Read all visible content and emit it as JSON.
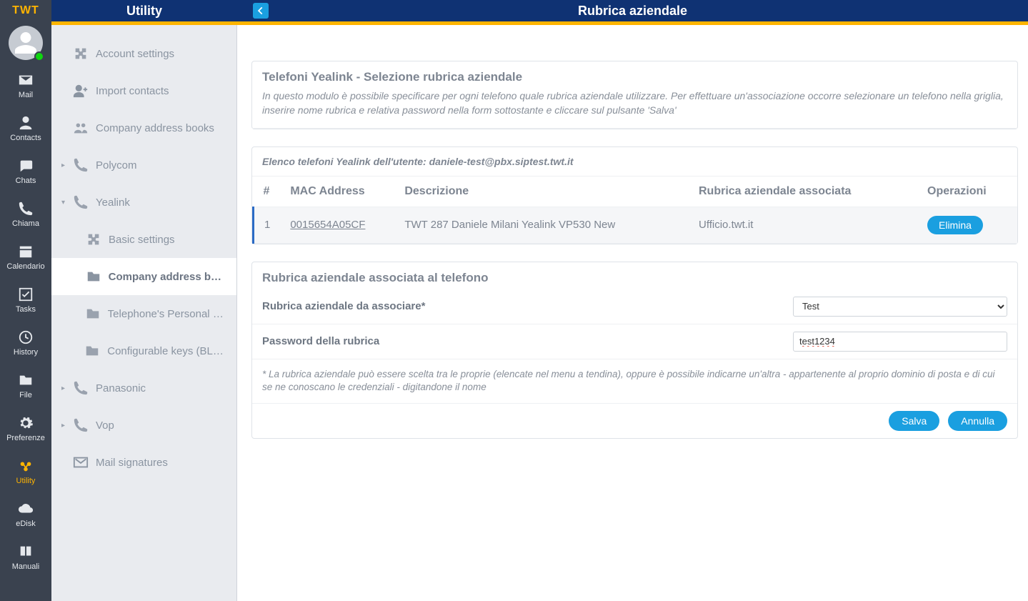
{
  "brand": "TWT",
  "header": {
    "left_title": "Utility",
    "right_title": "Rubrica aziendale"
  },
  "navrail": [
    {
      "id": "mail",
      "label": "Mail"
    },
    {
      "id": "contacts",
      "label": "Contacts"
    },
    {
      "id": "chats",
      "label": "Chats"
    },
    {
      "id": "chiama",
      "label": "Chiama"
    },
    {
      "id": "calendario",
      "label": "Calendario"
    },
    {
      "id": "tasks",
      "label": "Tasks"
    },
    {
      "id": "history",
      "label": "History"
    },
    {
      "id": "file",
      "label": "File"
    },
    {
      "id": "preferenze",
      "label": "Preferenze"
    },
    {
      "id": "utility",
      "label": "Utility",
      "active": true
    },
    {
      "id": "edisk",
      "label": "eDisk"
    },
    {
      "id": "manuali",
      "label": "Manuali"
    }
  ],
  "tree": [
    {
      "label": "Account settings",
      "icon": "puzzle"
    },
    {
      "label": "Import contacts",
      "icon": "person-plus"
    },
    {
      "label": "Company address books",
      "icon": "people"
    },
    {
      "label": "Polycom",
      "icon": "phone",
      "expander": "right"
    },
    {
      "label": "Yealink",
      "icon": "phone",
      "expander": "down"
    },
    {
      "label": "Basic settings",
      "icon": "puzzle",
      "child": true
    },
    {
      "label": "Company address book",
      "icon": "folder",
      "child": true,
      "active": true
    },
    {
      "label": "Telephone's Personal add…",
      "icon": "folder",
      "child": true
    },
    {
      "label": "Configurable keys (BLF - S…",
      "icon": "folder",
      "child": true
    },
    {
      "label": "Panasonic",
      "icon": "phone",
      "expander": "right"
    },
    {
      "label": "Vop",
      "icon": "phone",
      "expander": "right"
    },
    {
      "label": "Mail signatures",
      "icon": "mail"
    }
  ],
  "intro": {
    "title": "Telefoni Yealink - Selezione rubrica aziendale",
    "text": "In questo modulo è possibile specificare per ogni telefono quale rubrica aziendale utilizzare. Per effettuare un'associazione occorre selezionare un telefono nella griglia, inserire nome rubrica e relativa password nella form sottostante e cliccare sul pulsante 'Salva'"
  },
  "list": {
    "caption": "Elenco telefoni Yealink dell'utente: daniele-test@pbx.siptest.twt.it",
    "cols": {
      "n": "#",
      "mac": "MAC Address",
      "desc": "Descrizione",
      "rub": "Rubrica aziendale associata",
      "ops": "Operazioni"
    },
    "rows": [
      {
        "n": "1",
        "mac": "0015654A05CF",
        "desc": "TWT 287 Daniele Milani Yealink VP530 New",
        "rub": "Ufficio.twt.it",
        "op": "Elimina"
      }
    ]
  },
  "form": {
    "title": "Rubrica aziendale associata al telefono",
    "field_rubrica": "Rubrica aziendale da associare*",
    "field_password": "Password della rubrica",
    "select_value": "Test",
    "password_value": "test1234",
    "note": "* La rubrica aziendale può essere scelta tra le proprie (elencate nel menu a tendina), oppure è possibile indicarne un'altra - appartenente al proprio dominio di posta e di cui se ne conoscano le credenziali - digitandone il nome",
    "save": "Salva",
    "cancel": "Annulla"
  }
}
